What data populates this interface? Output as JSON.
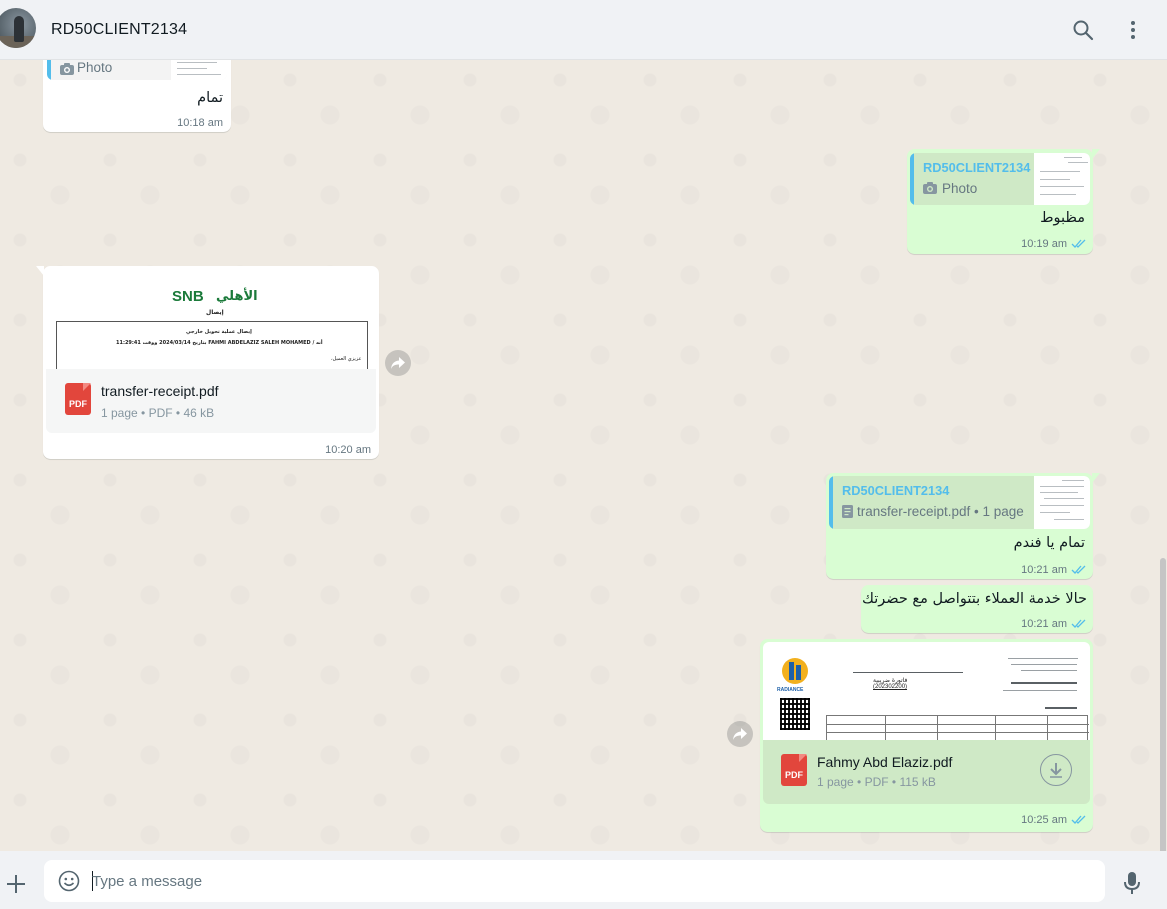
{
  "header": {
    "chat_name": "RD50CLIENT2134",
    "icons": [
      "search-icon",
      "menu-dots-icon"
    ]
  },
  "messages": {
    "m1": {
      "quote_text": "Photo",
      "text": "تمام",
      "time": "10:18 am"
    },
    "m2": {
      "quote_name": "RD50CLIENT2134",
      "quote_text": "Photo",
      "text": "مظبوط",
      "time": "10:19 am",
      "status": "read"
    },
    "m3": {
      "preview": {
        "logo_ar": "الأهلي",
        "logo_en": "SNB",
        "heading_ar": "إيصال",
        "title_ar": "إيصال عملية تحويل خارجي",
        "line_text": "أنه / FAHMI ABDELAZIZ SALEH MOHAMED بتاريخ 2024/03/14 ووقت 11:29:41",
        "salutation_ar": "عزيزي العميل،"
      },
      "file_name": "transfer-receipt.pdf",
      "file_meta": "1 page • PDF • 46 kB",
      "time": "10:20 am"
    },
    "m4": {
      "quote_name": "RD50CLIENT2134",
      "quote_text": "transfer-receipt.pdf • 1 page",
      "text": "تمام يا فندم",
      "time": "10:21 am",
      "status": "read"
    },
    "m5": {
      "text": "حالا خدمة العملاء بتتواصل مع حضرتك",
      "time": "10:21 am",
      "status": "read"
    },
    "m6": {
      "preview": {
        "doc_title_ar": "فاتورة ضريبية",
        "doc_number": "(202302200)",
        "logo_text": "RADIANCE"
      },
      "file_name": "Fahmy Abd Elaziz.pdf",
      "file_meta": "1 page • PDF • 115 kB",
      "time": "10:25 am",
      "status": "read"
    }
  },
  "composer": {
    "placeholder": "Type a message",
    "value": ""
  },
  "colors": {
    "header_bg": "#f0f2f5",
    "chat_bg": "#efeae2",
    "incoming_bubble": "#ffffff",
    "outgoing_bubble": "#d9fdd3",
    "quote_accent": "#53bdeb",
    "read_ticks": "#53bdeb",
    "pdf_red": "#e2463c"
  }
}
